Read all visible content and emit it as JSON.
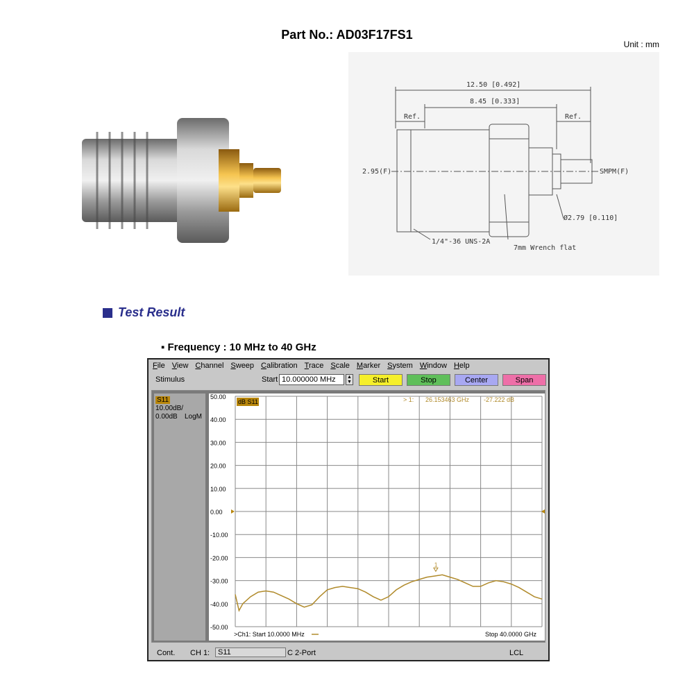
{
  "part_title": "Part No.: AD03F17FS1",
  "unit_label": "Unit : mm",
  "drawing": {
    "dim_overall": "12.50 [0.492]",
    "dim_body": "8.45 [0.333]",
    "ref_left": "Ref.",
    "ref_right": "Ref.",
    "left_port": "2.95(F)",
    "right_port": "SMPM(F)",
    "diameter": "Ø2.79 [0.110]",
    "thread": "1/4\"-36 UNS-2A",
    "wrench": "7mm Wrench flat"
  },
  "test_result_title": "Test Result",
  "frequency_title": "▪ Frequency : 10 MHz to 40 GHz",
  "vna": {
    "menu": [
      "File",
      "View",
      "Channel",
      "Sweep",
      "Calibration",
      "Trace",
      "Scale",
      "Marker",
      "System",
      "Window",
      "Help"
    ],
    "stimulus_label": "Stimulus",
    "start_label": "Start",
    "start_value": "10.000000 MHz",
    "buttons": {
      "start": "Start",
      "stop": "Stop",
      "center": "Center",
      "span": "Span"
    },
    "colors": {
      "start": "#f5ef2a",
      "stop": "#5fbf5a",
      "center": "#a8a8f2",
      "span": "#ee6fa8",
      "trace": "#b08a2a"
    },
    "trace_box": "S11",
    "scale_line": "10.00dB/",
    "ref_line": "0.00dB",
    "format": "LogM",
    "trace_tag": "dB S11",
    "marker_label": "> 1:",
    "marker_freq": "26.153463 GHz",
    "marker_value": "-27.222 dB",
    "marker_num": "1",
    "footer_start": ">Ch1: Start  10.0000 MHz",
    "footer_stop": "Stop  40.0000 GHz",
    "status": {
      "cont": "Cont.",
      "ch": "CH 1:",
      "param": "S11",
      "cal": "C  2-Port",
      "lcl": "LCL"
    }
  },
  "chart_data": {
    "type": "line",
    "title": "",
    "xlabel": "",
    "ylabel": "",
    "xlim": [
      0.01,
      40
    ],
    "ylim": [
      -50,
      50
    ],
    "y_ticks": [
      "50.00",
      "40.00",
      "30.00",
      "20.00",
      "10.00",
      "0.00",
      "-10.00",
      "-20.00",
      "-30.00",
      "-40.00",
      "-50.00"
    ],
    "series": [
      {
        "x": [
          0.01,
          0.5,
          1,
          2,
          3,
          4,
          5,
          6,
          7,
          8,
          9,
          10,
          11,
          12,
          13,
          14,
          15,
          16,
          17,
          18,
          19,
          20,
          21,
          22,
          23,
          24,
          25,
          26,
          27,
          28,
          29,
          30,
          31,
          32,
          33,
          34,
          35,
          36,
          37,
          38,
          39,
          40
        ],
        "y": [
          -36,
          -43,
          -40,
          -37,
          -35,
          -34.5,
          -35,
          -36.5,
          -38,
          -40,
          -41.5,
          -40.5,
          -37,
          -34,
          -33,
          -32.5,
          -33,
          -33.5,
          -35,
          -37,
          -38.5,
          -37,
          -34,
          -32,
          -30.5,
          -29.5,
          -28.5,
          -28,
          -27.5,
          -28.5,
          -29.5,
          -31,
          -32.5,
          -32.5,
          -31,
          -30,
          -30.5,
          -31.5,
          -33,
          -35,
          -37,
          -38
        ]
      }
    ]
  }
}
